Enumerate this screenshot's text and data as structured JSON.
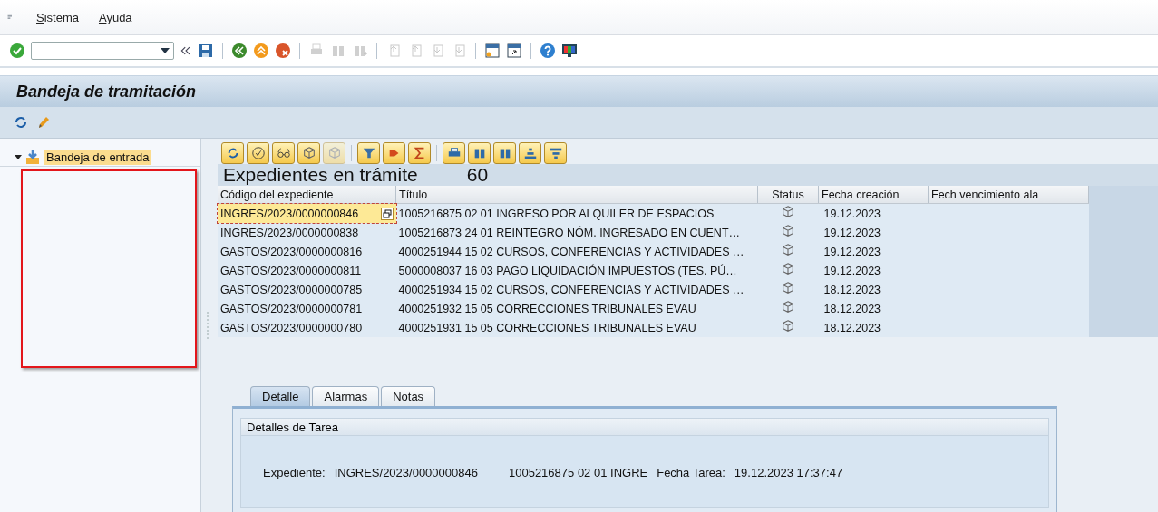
{
  "menu": [
    {
      "label": "Sistema"
    },
    {
      "label": "Ayuda"
    }
  ],
  "title": "Bandeja de tramitación",
  "tree": {
    "items": [
      {
        "label": "Bandeja de entrada",
        "expanded": true,
        "selected": true
      }
    ]
  },
  "list": {
    "heading": "Expedientes en trámite",
    "count": "60",
    "columns": [
      "Código del expediente",
      "Título",
      "Status",
      "Fecha creación",
      "Fech vencimiento ala"
    ],
    "rows": [
      {
        "code": "INGRES/2023/0000000846",
        "title": "1005216875 02 01 INGRESO POR ALQUILER DE ESPACIOS",
        "created": "19.12.2023",
        "selected": true
      },
      {
        "code": "INGRES/2023/0000000838",
        "title": "1005216873 24 01 REINTEGRO NÓM. INGRESADO EN CUENT…",
        "created": "19.12.2023",
        "selected": false
      },
      {
        "code": "GASTOS/2023/0000000816",
        "title": "4000251944 15 02 CURSOS, CONFERENCIAS Y ACTIVIDADES …",
        "created": "19.12.2023",
        "selected": false
      },
      {
        "code": "GASTOS/2023/0000000811",
        "title": "5000008037 16 03 PAGO LIQUIDACIÓN IMPUESTOS (TES. PÚ…",
        "created": "19.12.2023",
        "selected": false
      },
      {
        "code": "GASTOS/2023/0000000785",
        "title": "4000251934 15 02 CURSOS, CONFERENCIAS Y ACTIVIDADES …",
        "created": "18.12.2023",
        "selected": false
      },
      {
        "code": "GASTOS/2023/0000000781",
        "title": "4000251932 15 05 CORRECCIONES TRIBUNALES EVAU",
        "created": "18.12.2023",
        "selected": false
      },
      {
        "code": "GASTOS/2023/0000000780",
        "title": "4000251931 15 05 CORRECCIONES TRIBUNALES EVAU",
        "created": "18.12.2023",
        "selected": false
      }
    ]
  },
  "detail": {
    "tabs": [
      {
        "label": "Detalle",
        "selected": true
      },
      {
        "label": "Alarmas",
        "selected": false
      },
      {
        "label": "Notas",
        "selected": false
      }
    ],
    "section_title": "Detalles de Tarea",
    "expediente": {
      "label": "Expediente:",
      "value": "INGRES/2023/0000000846",
      "title": "1005216875 02 01 INGRE"
    },
    "fecha": {
      "label": "Fecha Tarea:",
      "value": "19.12.2023 17:37:47"
    }
  }
}
